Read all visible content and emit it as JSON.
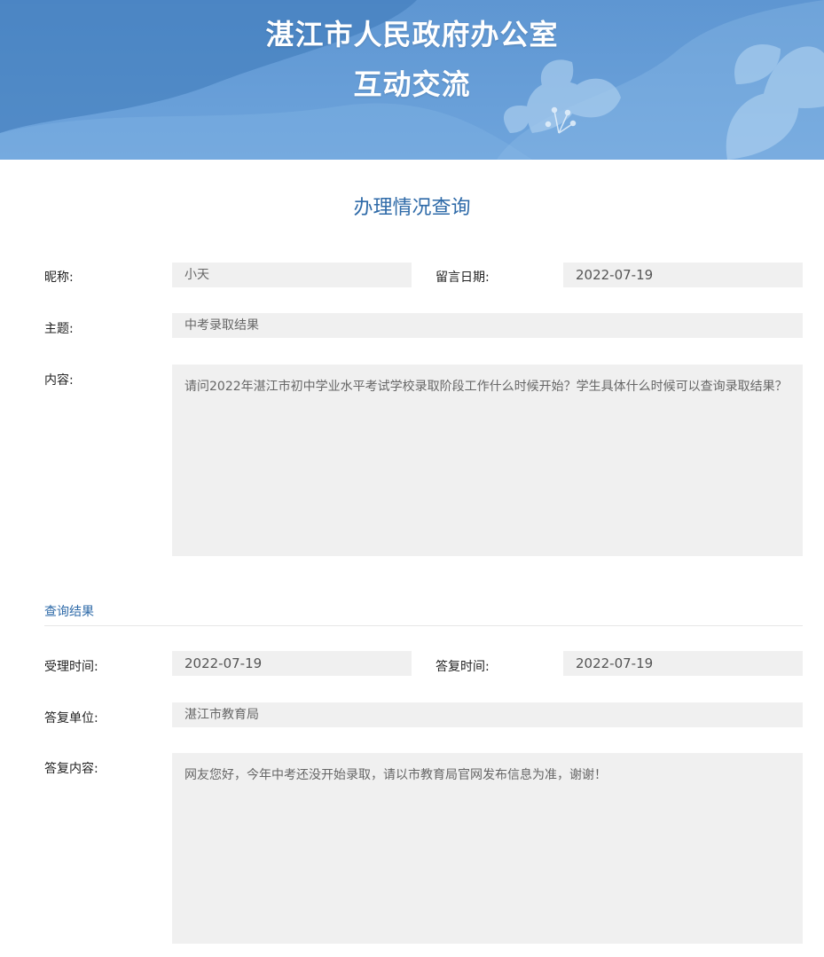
{
  "banner": {
    "title_line1": "湛江市人民政府办公室",
    "title_line2": "互动交流"
  },
  "heading": "办理情况查询",
  "message": {
    "nickname_label": "昵称:",
    "nickname": "小天",
    "date_label": "留言日期:",
    "date": "2022-07-19",
    "subject_label": "主题:",
    "subject": "中考录取结果",
    "content_label": "内容:",
    "content": "请问2022年湛江市初中学业水平考试学校录取阶段工作什么时候开始？学生具体什么时候可以查询录取结果？"
  },
  "result": {
    "section_title": "查询结果",
    "accept_time_label": "受理时间:",
    "accept_time": "2022-07-19",
    "reply_time_label": "答复时间:",
    "reply_time": "2022-07-19",
    "reply_unit_label": "答复单位:",
    "reply_unit": "湛江市教育局",
    "reply_content_label": "答复内容:",
    "reply_content": "网友您好，今年中考还没开始录取，请以市教育局官网发布信息为准，谢谢！"
  },
  "colors": {
    "banner": "#5e96d2",
    "accent": "#2e6aa8",
    "field_bg": "#f0f0f0"
  }
}
